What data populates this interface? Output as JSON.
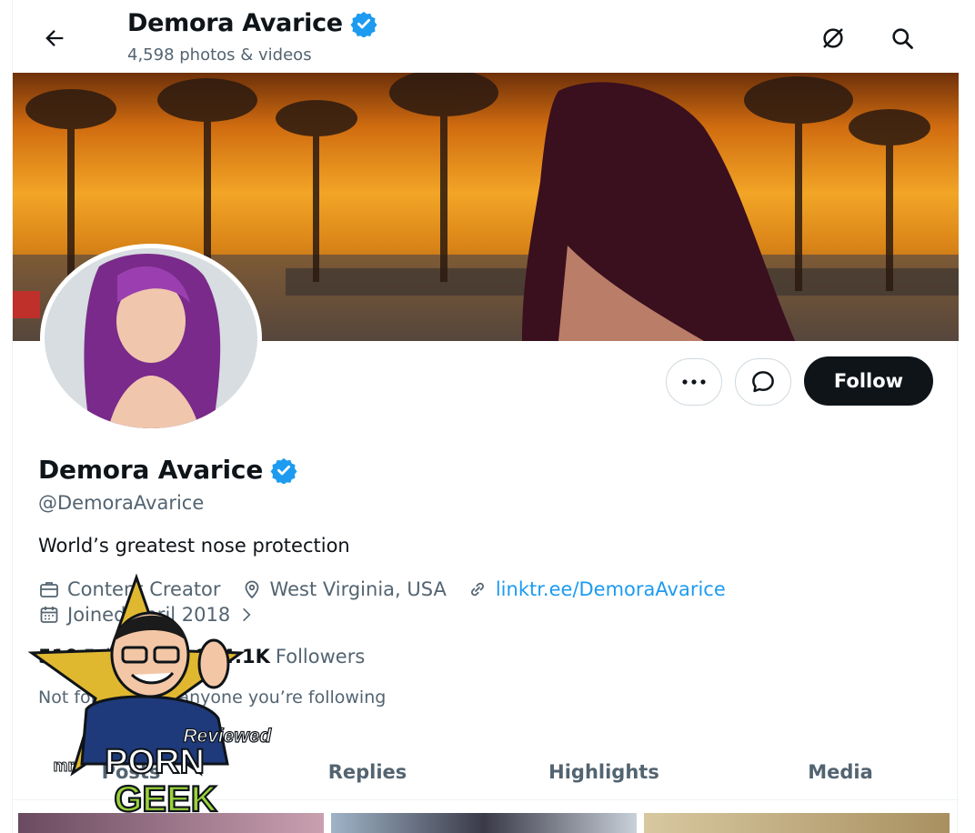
{
  "header": {
    "name": "Demora Avarice",
    "media_count": "4,598 photos & videos"
  },
  "profile": {
    "display_name": "Demora Avarice",
    "handle": "@DemoraAvarice",
    "bio": "World’s greatest nose protection",
    "category": "Content Creator",
    "location": "West Virginia, USA",
    "link": "linktr.ee/DemoraAvarice",
    "joined": "Joined April 2018",
    "following_count": "510",
    "following_label": "Following",
    "followers_count": "844.1K",
    "followers_label": "Followers",
    "followed_by": "Not followed by anyone you’re following"
  },
  "actions": {
    "follow_label": "Follow"
  },
  "tabs": [
    {
      "label": "Posts"
    },
    {
      "label": "Replies"
    },
    {
      "label": "Highlights"
    },
    {
      "label": "Media"
    }
  ],
  "watermark": {
    "line1": "Reviewed by",
    "line2": "mr",
    "line3": "PORN",
    "line4": "GEEK"
  },
  "colors": {
    "accent": "#1d9bf0",
    "verified": "#1d9bf0",
    "follow_bg": "#0f1419",
    "muted_text": "#536471"
  },
  "icons": [
    "back-arrow-icon",
    "verified-badge-icon",
    "hide-icon",
    "search-icon",
    "more-icon",
    "message-icon",
    "briefcase-icon",
    "location-pin-icon",
    "link-icon",
    "calendar-icon",
    "chevron-right-icon"
  ]
}
